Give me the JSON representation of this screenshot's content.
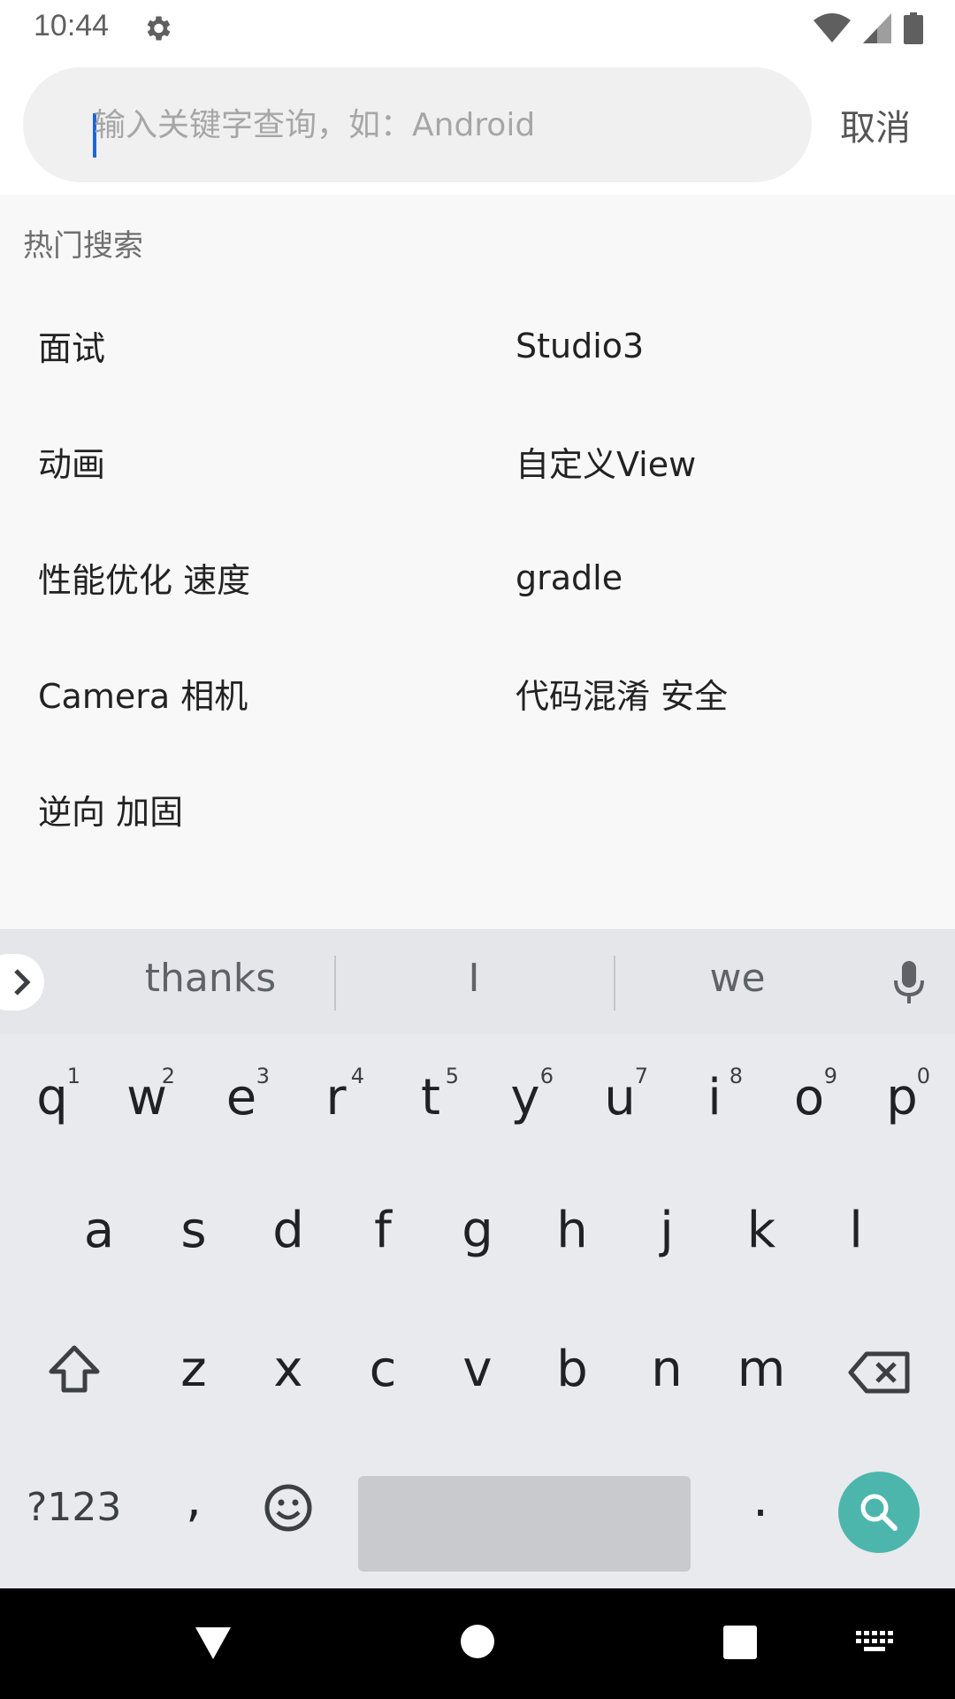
{
  "status_bar": {
    "time": "10:44",
    "icons": [
      "gear-icon",
      "wifi-icon",
      "signal-icon",
      "battery-icon"
    ]
  },
  "search": {
    "placeholder": "输入关键字查询，如：Android",
    "value": "",
    "cancel_label": "取消"
  },
  "hot_search": {
    "title": "热门搜索",
    "items": [
      "面试",
      "Studio3",
      "动画",
      "自定义View",
      "性能优化 速度",
      "gradle",
      "Camera 相机",
      "代码混淆 安全",
      "逆向 加固"
    ]
  },
  "keyboard": {
    "suggestions": [
      "thanks",
      "I",
      "we"
    ],
    "row1": [
      {
        "ch": "q",
        "num": "1"
      },
      {
        "ch": "w",
        "num": "2"
      },
      {
        "ch": "e",
        "num": "3"
      },
      {
        "ch": "r",
        "num": "4"
      },
      {
        "ch": "t",
        "num": "5"
      },
      {
        "ch": "y",
        "num": "6"
      },
      {
        "ch": "u",
        "num": "7"
      },
      {
        "ch": "i",
        "num": "8"
      },
      {
        "ch": "o",
        "num": "9"
      },
      {
        "ch": "p",
        "num": "0"
      }
    ],
    "row2": [
      "a",
      "s",
      "d",
      "f",
      "g",
      "h",
      "j",
      "k",
      "l"
    ],
    "row3": [
      "z",
      "x",
      "c",
      "v",
      "b",
      "n",
      "m"
    ],
    "symbols_label": "?123",
    "comma": ",",
    "period": ".",
    "accent_color": "#4db6ac"
  }
}
